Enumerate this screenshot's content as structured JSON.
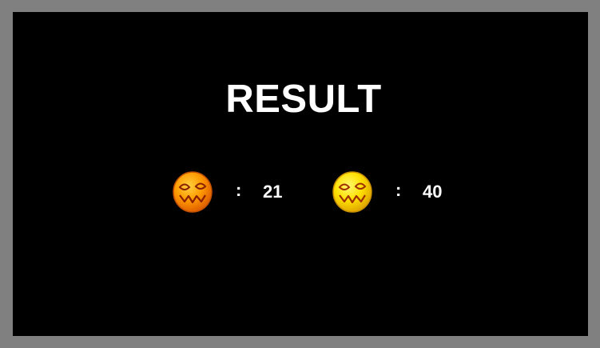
{
  "title": "RESULT",
  "colors": {
    "frame": "#808080",
    "screen": "#000000",
    "text": "#ffffff",
    "player_a_face": "#ff9900",
    "player_b_face": "#ffe000",
    "face_outline": "#c04000"
  },
  "scores": [
    {
      "icon": "orange-pumpkin-face-icon",
      "separator": ":",
      "value": "21"
    },
    {
      "icon": "yellow-pumpkin-face-icon",
      "separator": ":",
      "value": "40"
    }
  ]
}
